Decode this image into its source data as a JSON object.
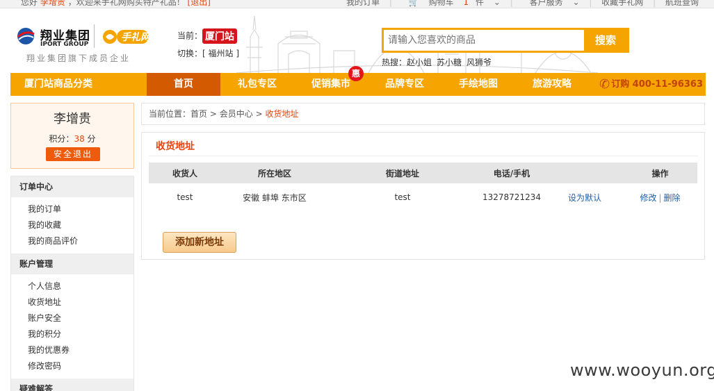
{
  "topbar": {
    "greeting": "您好",
    "username": "李增贵",
    "welcome": "，欢迎来手礼网购买特产礼品！",
    "logout": "[退出]",
    "links": [
      "我的订单",
      "购物车",
      "客户服务",
      "收藏手礼网",
      "航班查询"
    ],
    "cart_count": "1",
    "cart_unit": "件"
  },
  "header": {
    "logo_cn": "翔业集团",
    "logo_en": "IPORT GROUP",
    "gift_logo": "手礼网",
    "tagline": "翔业集团旗下成员企业",
    "current_label": "当前：",
    "current_station": "厦门站",
    "switch_label": "切换：",
    "switch_station": "[ 福州站 ]"
  },
  "search": {
    "placeholder": "请输入您喜欢的商品",
    "button": "搜索",
    "hot_label": "热搜：",
    "hot_terms": [
      "赵小姐",
      "苏小糖",
      "风狮爷"
    ]
  },
  "nav": {
    "category": "厦门站商品分类",
    "items": [
      "首页",
      "礼包专区",
      "促销集市",
      "品牌专区",
      "手绘地图",
      "旅游攻略"
    ],
    "active_index": 0,
    "promo_badge": "惠",
    "hotline_label": "订购",
    "hotline": "400-11-96363"
  },
  "user": {
    "name": "李增贵",
    "points_label": "积分：",
    "points": "38",
    "points_unit": "分",
    "logout_button": "安全退出"
  },
  "menu": {
    "sections": [
      {
        "title": "订单中心",
        "items": [
          "我的订单",
          "我的收藏",
          "我的商品评价"
        ]
      },
      {
        "title": "账户管理",
        "items": [
          "个人信息",
          "收货地址",
          "账户安全",
          "我的积分",
          "我的优惠券",
          "修改密码"
        ]
      },
      {
        "title": "疑难解答",
        "items": []
      }
    ]
  },
  "breadcrumb": {
    "label": "当前位置：",
    "home": "首页",
    "member": "会员中心",
    "current": "收货地址",
    "separator": ">"
  },
  "address_panel": {
    "title": "收货地址",
    "columns": [
      "收货人",
      "所在地区",
      "街道地址",
      "电话/手机",
      "",
      "操作"
    ],
    "rows": [
      {
        "name": "test",
        "region": "安徽 蚌埠 东市区",
        "street": "test",
        "phone": "13278721234",
        "set_default": "设为默认",
        "edit": "修改",
        "delete": "删除"
      }
    ],
    "add_button": "添加新地址"
  },
  "watermark": "www.wooyun.org",
  "colors": {
    "accent": "#f6a400",
    "nav_active": "#d35a00",
    "highlight": "#e8440c",
    "link": "#1f5fa8"
  }
}
